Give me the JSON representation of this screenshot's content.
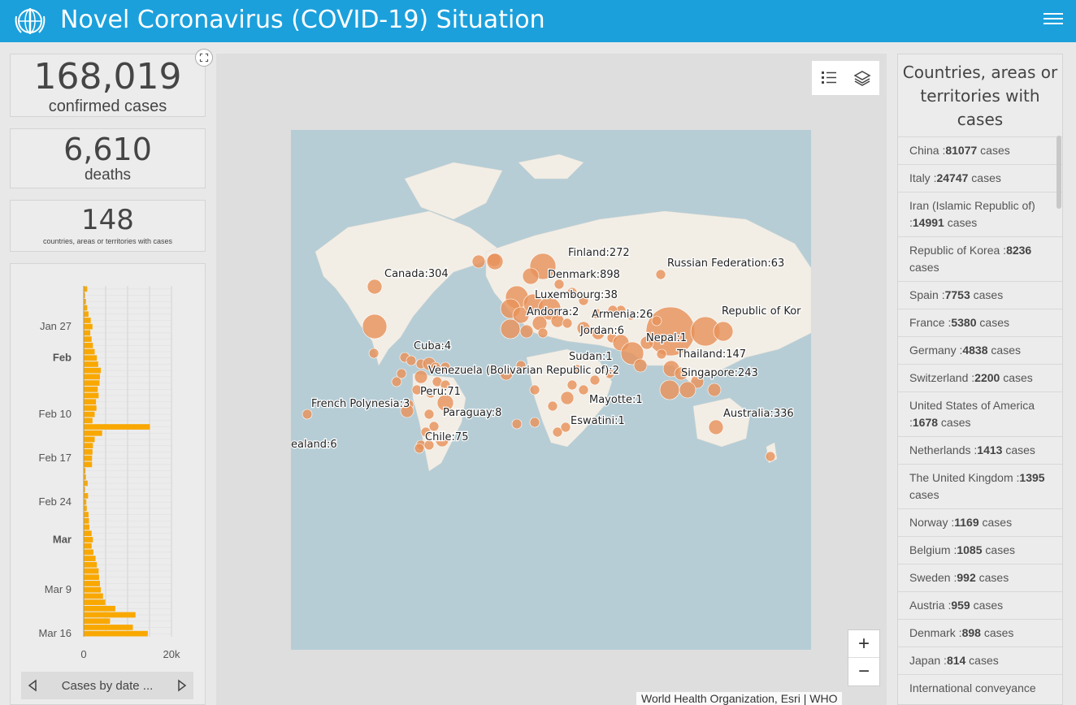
{
  "header": {
    "title": "Novel Coronavirus (COVID-19) Situation",
    "logo": "who-emblem-icon",
    "menu_icon": "hamburger-menu-icon",
    "bg_color": "#1ba0dc"
  },
  "stats": {
    "confirmed_value": "168,019",
    "confirmed_label": "confirmed cases",
    "deaths_value": "6,610",
    "deaths_label": "deaths",
    "countries_value": "148",
    "countries_label": "countries, areas or territories with cases"
  },
  "chart_data": {
    "type": "bar",
    "orientation": "horizontal",
    "title": "",
    "xlabel": "",
    "ylabel": "",
    "x_ticks": [
      "0",
      "20k"
    ],
    "xlim": [
      0,
      20000
    ],
    "y_tick_labels": [
      "Jan 27",
      "Feb",
      "Feb 10",
      "Feb 17",
      "Feb 24",
      "Mar",
      "Mar 9",
      "Mar 16"
    ],
    "categories": [
      "Jan 21",
      "Jan 22",
      "Jan 23",
      "Jan 24",
      "Jan 25",
      "Jan 26",
      "Jan 27",
      "Jan 28",
      "Jan 29",
      "Jan 30",
      "Jan 31",
      "Feb 1",
      "Feb 2",
      "Feb 3",
      "Feb 4",
      "Feb 5",
      "Feb 6",
      "Feb 7",
      "Feb 8",
      "Feb 9",
      "Feb 10",
      "Feb 11",
      "Feb 12",
      "Feb 13",
      "Feb 14",
      "Feb 15",
      "Feb 16",
      "Feb 17",
      "Feb 18",
      "Feb 19",
      "Feb 20",
      "Feb 21",
      "Feb 22",
      "Feb 23",
      "Feb 24",
      "Feb 25",
      "Feb 26",
      "Feb 27",
      "Feb 28",
      "Feb 29",
      "Mar 1",
      "Mar 2",
      "Mar 3",
      "Mar 4",
      "Mar 5",
      "Mar 6",
      "Mar 7",
      "Mar 8",
      "Mar 9",
      "Mar 10",
      "Mar 11",
      "Mar 12",
      "Mar 13",
      "Mar 14",
      "Mar 15",
      "Mar 16"
    ],
    "values": [
      800,
      300,
      500,
      800,
      1100,
      1600,
      2000,
      1500,
      1800,
      2100,
      2500,
      3000,
      3300,
      3900,
      3700,
      3600,
      3200,
      3400,
      2800,
      2900,
      2500,
      2000,
      15100,
      4200,
      2500,
      2100,
      2000,
      1900,
      1900,
      400,
      500,
      900,
      300,
      1000,
      600,
      700,
      1100,
      1200,
      1300,
      1800,
      2100,
      1800,
      2200,
      2700,
      3000,
      3400,
      3500,
      3700,
      3900,
      4400,
      4900,
      7200,
      11800,
      6000,
      11200,
      14600
    ],
    "series_color": "#f9a800",
    "grid": true
  },
  "chart_footer": {
    "label": "Cases by date ...",
    "prev_icon": "triangle-left-icon",
    "next_icon": "triangle-right-icon"
  },
  "map": {
    "tools": [
      "legend-list-icon",
      "layers-icon"
    ],
    "zoom_in": "+",
    "zoom_out": "−",
    "attribution": "World Health Organization, Esri | WHO",
    "bubble_color": "#e8925a",
    "labels": [
      {
        "text": "Finland:272"
      },
      {
        "text": "Russian Federation:63"
      },
      {
        "text": "Canada:304"
      },
      {
        "text": "Denmark:898"
      },
      {
        "text": "Luxembourg:38"
      },
      {
        "text": "Andorra:2"
      },
      {
        "text": "Armenia:26"
      },
      {
        "text": "Republic of Kor"
      },
      {
        "text": "Jordan:6"
      },
      {
        "text": "Nepal:1"
      },
      {
        "text": "Cuba:4"
      },
      {
        "text": "Sudan:1"
      },
      {
        "text": "Thailand:147"
      },
      {
        "text": "Venezuela (Bolivarian Republic of):2"
      },
      {
        "text": "Singapore:243"
      },
      {
        "text": "Peru:71"
      },
      {
        "text": "Mayotte:1"
      },
      {
        "text": "French Polynesia:3"
      },
      {
        "text": "Paraguay:8"
      },
      {
        "text": "Australia:336"
      },
      {
        "text": "Eswatini:1"
      },
      {
        "text": "Chile:75"
      },
      {
        "text": "ealand:6"
      }
    ]
  },
  "country_list": {
    "title": "Countries, areas or territories with cases",
    "items": [
      {
        "name": "China :",
        "count": "81077",
        "unit": " cases"
      },
      {
        "name": "Italy :",
        "count": "24747",
        "unit": " cases"
      },
      {
        "name": "Iran (Islamic Republic of) :",
        "count": "14991",
        "unit": " cases"
      },
      {
        "name": "Republic of Korea :",
        "count": "8236",
        "unit": " cases"
      },
      {
        "name": "Spain :",
        "count": "7753",
        "unit": " cases"
      },
      {
        "name": "France :",
        "count": "5380",
        "unit": " cases"
      },
      {
        "name": "Germany :",
        "count": "4838",
        "unit": " cases"
      },
      {
        "name": "Switzerland :",
        "count": "2200",
        "unit": " cases"
      },
      {
        "name": "United States of America :",
        "count": "1678",
        "unit": " cases"
      },
      {
        "name": "Netherlands :",
        "count": "1413",
        "unit": " cases"
      },
      {
        "name": "The United Kingdom :",
        "count": "1395",
        "unit": " cases"
      },
      {
        "name": "Norway :",
        "count": "1169",
        "unit": " cases"
      },
      {
        "name": "Belgium :",
        "count": "1085",
        "unit": " cases"
      },
      {
        "name": "Sweden :",
        "count": "992",
        "unit": " cases"
      },
      {
        "name": "Austria :",
        "count": "959",
        "unit": " cases"
      },
      {
        "name": "Denmark :",
        "count": "898",
        "unit": " cases"
      },
      {
        "name": "Japan :",
        "count": "814",
        "unit": " cases"
      },
      {
        "name": "International conveyance",
        "count": "",
        "unit": ""
      }
    ]
  }
}
